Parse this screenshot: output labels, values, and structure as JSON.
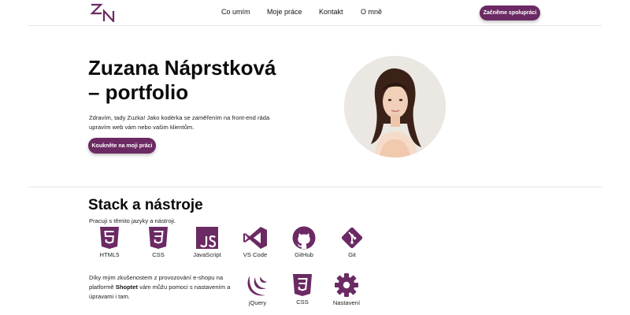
{
  "brand": {
    "logo_text": "ZN",
    "accent": "#6b2a63"
  },
  "nav": {
    "items": [
      {
        "label": "Co umím"
      },
      {
        "label": "Moje práce"
      },
      {
        "label": "Kontakt"
      },
      {
        "label": "O mně"
      }
    ],
    "cta_label": "Začněme spolupráci"
  },
  "hero": {
    "title_line1": "Zuzana Náprstková",
    "title_line2": "– portfolio",
    "intro": "Zdravím, tady Zuzka! Jako kodérka se zaměřením na front-end ráda upravím web vám nebo vašim klientům.",
    "cta_label": "Koukněte na moji práci"
  },
  "stack": {
    "title": "Stack a nástroje",
    "subtitle": "Pracuji s těmito jazyky a nástroji.",
    "tools": [
      {
        "label": "HTML5",
        "icon": "html5-icon"
      },
      {
        "label": "CSS",
        "icon": "css3-icon"
      },
      {
        "label": "JavaScript",
        "icon": "javascript-icon"
      },
      {
        "label": "VS Code",
        "icon": "vscode-icon"
      },
      {
        "label": "GitHub",
        "icon": "github-icon"
      },
      {
        "label": "Git",
        "icon": "git-icon"
      }
    ],
    "shoptet": {
      "text_before": "Díky mým zkušenostem z provozování e-shopu na platformě ",
      "highlight": "Shoptet",
      "text_after": " vám můžu pomoci s nastavením a úpravami i tam.",
      "tools": [
        {
          "label": "jQuery",
          "icon": "jquery-icon"
        },
        {
          "label": "CSS",
          "icon": "css3-icon"
        },
        {
          "label": "Nastavení",
          "icon": "gear-icon"
        }
      ]
    }
  }
}
